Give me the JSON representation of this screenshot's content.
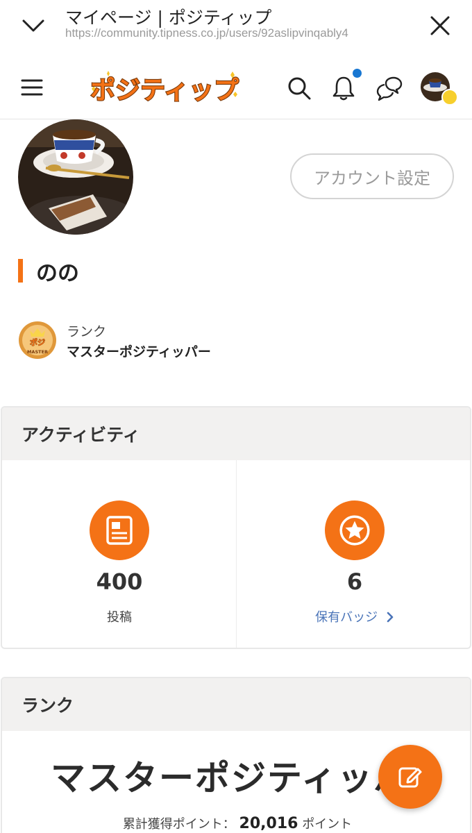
{
  "browser": {
    "title": "マイページ | ポジティップ",
    "url": "https://community.tipness.co.jp/users/92aslipvinqably4"
  },
  "header": {
    "logo_text": "ポジティップ",
    "icons": [
      "menu-icon",
      "search-icon",
      "bell-icon",
      "chat-icon",
      "avatar"
    ],
    "has_unread_notification": true
  },
  "profile": {
    "account_settings_label": "アカウント設定",
    "name": "のの",
    "rank_label": "ランク",
    "rank_value": "マスターポジティッパー",
    "medal_text": "MASTER"
  },
  "activity": {
    "title": "アクティビティ",
    "posts_count": "400",
    "posts_label": "投稿",
    "badges_count": "6",
    "badges_label": "保有バッジ"
  },
  "rank_card": {
    "title": "ランク",
    "rank_name": "マスターポジティッパー",
    "points_label": "累計獲得ポイント：",
    "points_value": "20,016",
    "points_unit": "ポイント"
  },
  "colors": {
    "accent": "#f47216",
    "link": "#4a74b8",
    "notification": "#1877d2"
  }
}
